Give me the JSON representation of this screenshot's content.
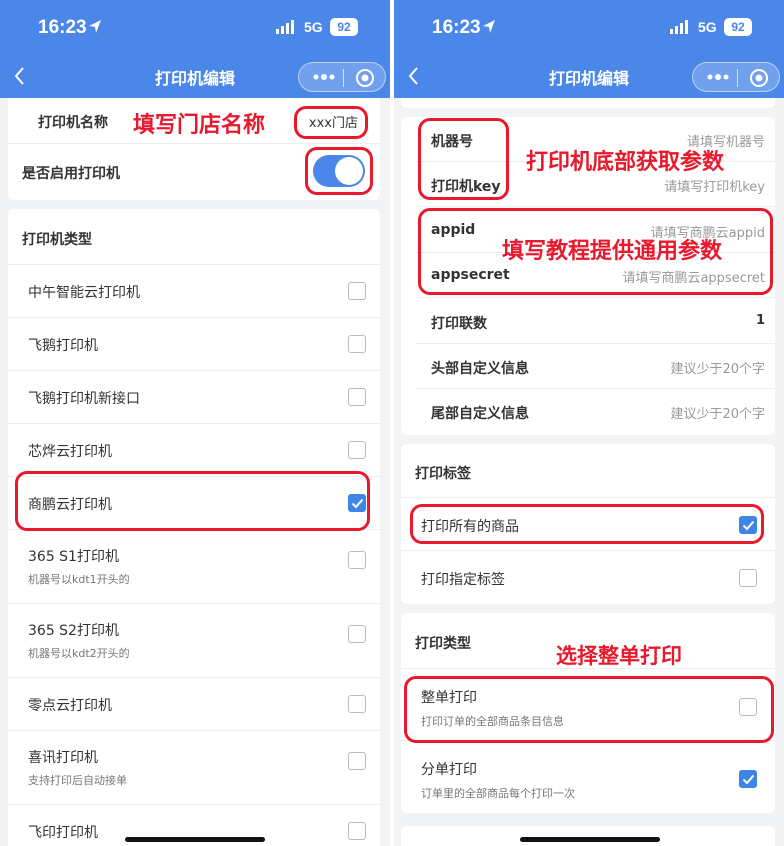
{
  "status": {
    "time": "16:23",
    "network": "5G",
    "battery": "92"
  },
  "left": {
    "title": "打印机编辑",
    "name_label": "打印机名称",
    "name_value": "xxx门店",
    "enable_label": "是否启用打印机",
    "type_header": "打印机类型",
    "types": [
      {
        "label": "中午智能云打印机",
        "sub": "",
        "checked": false
      },
      {
        "label": "飞鹅打印机",
        "sub": "",
        "checked": false
      },
      {
        "label": "飞鹅打印机新接口",
        "sub": "",
        "checked": false
      },
      {
        "label": "芯烨云打印机",
        "sub": "",
        "checked": false
      },
      {
        "label": "商鹏云打印机",
        "sub": "",
        "checked": true
      },
      {
        "label": "365 S1打印机",
        "sub": "机器号以kdt1开头的",
        "checked": false
      },
      {
        "label": "365 S2打印机",
        "sub": "机器号以kdt2开头的",
        "checked": false
      },
      {
        "label": "零点云打印机",
        "sub": "",
        "checked": false
      },
      {
        "label": "喜讯打印机",
        "sub": "支持打印后自动接单",
        "checked": false
      },
      {
        "label": "飞印打印机",
        "sub": "",
        "checked": false
      }
    ],
    "annotation": "填写门店名称"
  },
  "right": {
    "title": "打印机编辑",
    "fields": [
      {
        "label": "机器号",
        "value": "请填写机器号"
      },
      {
        "label": "打印机key",
        "value": "请填写打印机key"
      },
      {
        "label": "appid",
        "value": "请填写商鹏云appid"
      },
      {
        "label": "appsecret",
        "value": "请填写商鹏云appsecret"
      },
      {
        "label": "打印联数",
        "value": "1"
      },
      {
        "label": "头部自定义信息",
        "value": "建议少于20个字"
      },
      {
        "label": "尾部自定义信息",
        "value": "建议少于20个字"
      }
    ],
    "label_header": "打印标签",
    "label_options": [
      {
        "label": "打印所有的商品",
        "checked": true
      },
      {
        "label": "打印指定标签",
        "checked": false
      }
    ],
    "print_type_header": "打印类型",
    "print_types": [
      {
        "label": "整单打印",
        "sub": "打印订单的全部商品条目信息",
        "checked": false
      },
      {
        "label": "分单打印",
        "sub": "订单里的全部商品每个打印一次",
        "checked": true
      }
    ],
    "annotations": [
      "打印机底部获取参数",
      "填写教程提供通用参数",
      "选择整单打印"
    ]
  },
  "colors": {
    "brand": "#4a87e8",
    "annotation": "#e8192c",
    "checkbox_on": "#3d85e6"
  },
  "icons": [
    "location-arrow-icon",
    "signal-icon",
    "battery-icon",
    "back-chevron-icon",
    "more-icon",
    "close-circle-icon",
    "checkmark-icon"
  ]
}
